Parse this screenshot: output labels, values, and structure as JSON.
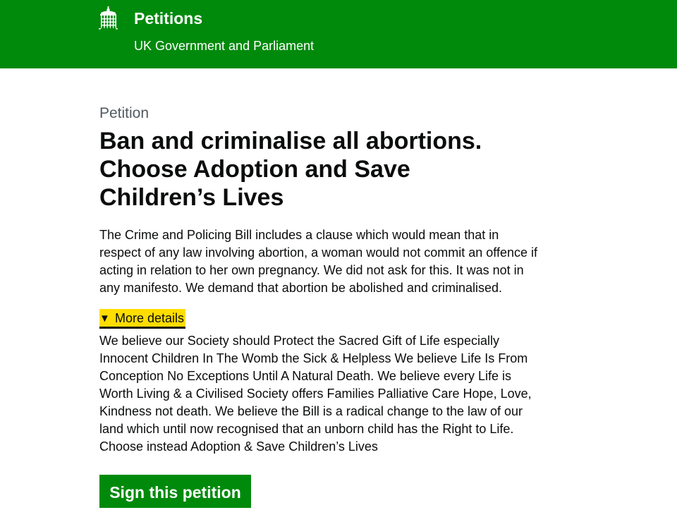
{
  "header": {
    "crest_icon": "portcullis-icon",
    "title": "Petitions",
    "subtitle": "UK Government and Parliament",
    "background_color": "#008a0c"
  },
  "petition": {
    "caption": "Petition",
    "title_lines": [
      "Ban and criminalise all abortions.",
      "Choose Adoption and Save",
      "Children’s Lives"
    ],
    "action": "The Crime and Policing Bill includes a clause which would mean that in respect of any law involving abortion, a woman would not commit an offence if acting in relation to her own pregnancy. We did not ask for this. It was not in any manifesto. We demand that abortion be abolished and criminalised.",
    "details_toggle": {
      "arrow": "▼",
      "label": "More details",
      "expanded": true,
      "highlight_color": "#ffdd00"
    },
    "details": "We believe our Society should Protect the Sacred Gift of Life especially Innocent Children In The Womb the Sick & Helpless We believe Life Is From Conception No Exceptions Until A Natural Death. We believe every Life is Worth Living & a Civilised Society offers Families Palliative Care Hope, Love, Kindness not death. We believe the Bill is a radical change to the law of our land which until now recognised that an unborn child has the Right to Life. Choose instead Adoption & Save Children’s Lives",
    "sign_button_label": "Sign this petition",
    "sign_button_color": "#008a0c"
  }
}
